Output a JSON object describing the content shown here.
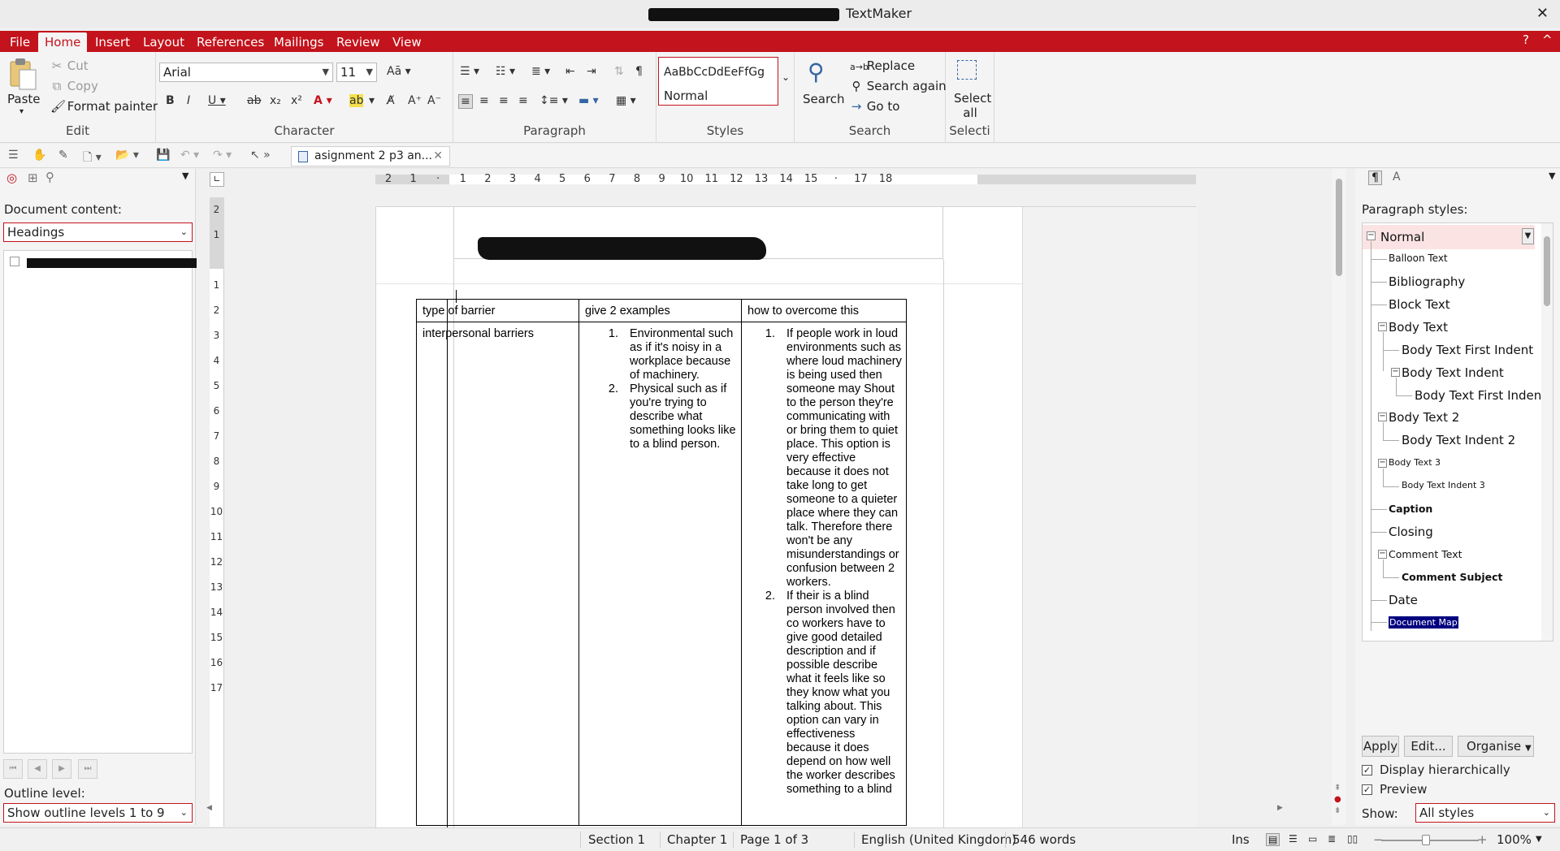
{
  "window": {
    "title": "TextMaker"
  },
  "menu": {
    "tabs": [
      "File",
      "Home",
      "Insert",
      "Layout",
      "References",
      "Mailings",
      "Review",
      "View"
    ],
    "active": "Home",
    "help": "?",
    "collapse": "^"
  },
  "ribbon": {
    "edit": {
      "paste": "Paste",
      "cut": "Cut",
      "copy": "Copy",
      "format_painter": "Format painter",
      "label": "Edit"
    },
    "character": {
      "font": "Arial",
      "size": "11",
      "label": "Character"
    },
    "paragraph": {
      "label": "Paragraph"
    },
    "styles": {
      "preview": "AaBbCcDdEeFfGg",
      "current": "Normal",
      "label": "Styles"
    },
    "search": {
      "search": "Search",
      "replace": "Replace",
      "search_again": "Search again",
      "goto": "Go to",
      "label": "Search"
    },
    "selection": {
      "select_all": "Select all",
      "label": "Selecti"
    }
  },
  "doc_tab": {
    "name": "asignment 2 p3 an..."
  },
  "left_panel": {
    "doc_content_label": "Document content:",
    "filter": "Headings",
    "outline_label": "Outline level:",
    "outline_value": "Show outline levels 1 to 9"
  },
  "ruler": {
    "h": [
      "2",
      "1",
      "",
      "1",
      "2",
      "3",
      "4",
      "5",
      "6",
      "7",
      "8",
      "9",
      "10",
      "11",
      "12",
      "13",
      "14",
      "15",
      "",
      "17",
      "18"
    ],
    "v_top": [
      "2",
      "1"
    ],
    "v": [
      "1",
      "2",
      "3",
      "4",
      "5",
      "6",
      "7",
      "8",
      "9",
      "10",
      "11",
      "12",
      "13",
      "14",
      "15",
      "16",
      "17"
    ]
  },
  "document": {
    "table": {
      "headers": [
        "type of barrier",
        "give 2 examples",
        "how to overcome this"
      ],
      "row_type": "interpersonal barriers",
      "examples": [
        "Environmental such as if it's noisy in a workplace because of machinery.",
        "Physical such as if you're trying to describe what something looks like to a blind person."
      ],
      "overcome": [
        "If people work in loud environments such as where loud machinery is being used then someone may Shout to the person they're communicating with or bring them to quiet place. This option is very effective because it does not take long to get someone to a quieter place where they can talk. Therefore there won't be any misunderstandings or confusion between 2 workers.",
        "If their is a blind person involved then co workers have to give good detailed description and if possible describe what it feels like so they know what you talking about. This option can vary in effectiveness because it does depend on how well the worker describes something to a blind"
      ]
    }
  },
  "right_panel": {
    "label": "Paragraph styles:",
    "styles": [
      "Normal",
      "Balloon Text",
      "Bibliography",
      "Block Text",
      "Body Text",
      "Body Text First Indent",
      "Body Text Indent",
      "Body Text First Indent",
      "Body Text 2",
      "Body Text Indent 2",
      "Body Text 3",
      "Body Text Indent 3",
      "Caption",
      "Closing",
      "Comment Text",
      "Comment Subject",
      "Date",
      "Document Map"
    ],
    "apply": "Apply",
    "edit": "Edit...",
    "organise": "Organise",
    "display_hier": "Display hierarchically",
    "preview": "Preview",
    "show_label": "Show:",
    "show_value": "All styles"
  },
  "status": {
    "section": "Section 1",
    "chapter": "Chapter 1",
    "page": "Page 1 of 3",
    "language": "English (United Kingdom)",
    "words": "546 words",
    "mode": "Ins",
    "zoom": "100%"
  },
  "colors": {
    "accent": "#c3131c",
    "selection": "#00007f"
  }
}
